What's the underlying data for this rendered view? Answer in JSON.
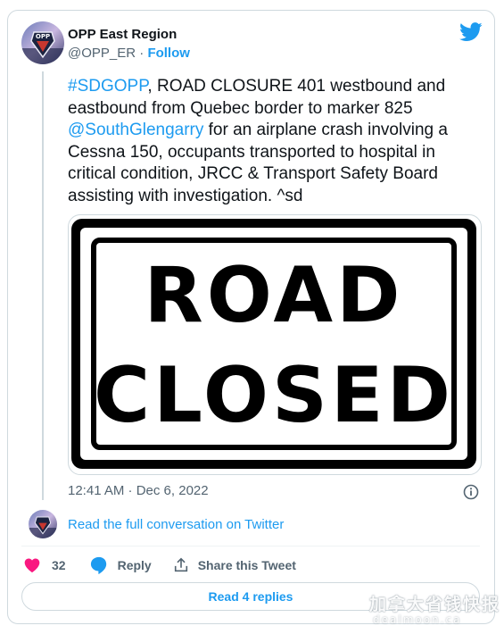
{
  "author": {
    "name": "OPP East Region",
    "handle": "@OPP_ER",
    "separator": "·",
    "follow_label": "Follow",
    "avatar_text": "OPP"
  },
  "tweet": {
    "hashtag": "#SDGOPP",
    "text_1": ", ROAD CLOSURE 401 westbound and eastbound from Quebec border to marker 825 ",
    "mention": "@SouthGlengarry",
    "text_2": " for an airplane crash involving a Cessna 150, occupants transported to hospital in critical condition, JRCC & Transport Safety Board assisting with investigation. ^sd"
  },
  "media": {
    "sign_line_1": "ROAD",
    "sign_line_2": "CLOSED"
  },
  "meta": {
    "timestamp": "12:41 AM · Dec 6, 2022"
  },
  "read_more_label": "Read the full conversation on Twitter",
  "actions": {
    "like_count": "32",
    "reply_label": "Reply",
    "share_label": "Share this Tweet"
  },
  "replies_button_label": "Read 4 replies",
  "watermark": {
    "line1": "加拿大省钱快报",
    "line2": "dealmoon.ca"
  },
  "colors": {
    "link": "#1d9bf0",
    "like": "#f91880",
    "text": "#0f1419",
    "muted": "#536471",
    "border": "#cfd9de"
  }
}
